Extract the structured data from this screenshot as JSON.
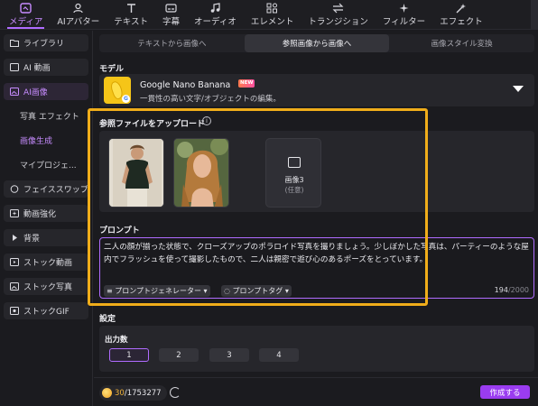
{
  "toolbar": {
    "items": [
      {
        "label": "メディア",
        "icon": "media-icon",
        "active": true
      },
      {
        "label": "AIアバター",
        "icon": "avatar-icon"
      },
      {
        "label": "テキスト",
        "icon": "text-icon"
      },
      {
        "label": "字幕",
        "icon": "caption-icon"
      },
      {
        "label": "オーディオ",
        "icon": "audio-icon"
      },
      {
        "label": "エレメント",
        "icon": "element-icon"
      },
      {
        "label": "トランジション",
        "icon": "transition-icon"
      },
      {
        "label": "フィルター",
        "icon": "filter-icon"
      },
      {
        "label": "エフェクト",
        "icon": "effect-icon"
      }
    ]
  },
  "sidebar": {
    "items": [
      {
        "label": "ライブラリ",
        "icon": "folder-icon"
      },
      {
        "label": "AI 動画",
        "icon": "ai-video-icon"
      },
      {
        "label": "AI画像",
        "icon": "ai-image-icon",
        "active": true
      },
      {
        "label": "写真 エフェクト",
        "sub": true
      },
      {
        "label": "画像生成",
        "sub": true,
        "active": true
      },
      {
        "label": "マイプロジェ...",
        "sub": true
      },
      {
        "label": "フェイススワップ",
        "icon": "face-swap-icon"
      },
      {
        "label": "動画強化",
        "icon": "enhance-icon"
      },
      {
        "label": "背景",
        "icon": "triangle-icon"
      },
      {
        "label": "ストック動画",
        "icon": "stock-video-icon"
      },
      {
        "label": "ストック写真",
        "icon": "stock-photo-icon"
      },
      {
        "label": "ストックGIF",
        "icon": "gif-icon"
      }
    ]
  },
  "tabs": [
    {
      "label": "テキストから画像へ"
    },
    {
      "label": "参照画像から画像へ",
      "active": true
    },
    {
      "label": "画像スタイル変換"
    }
  ],
  "model": {
    "section_title": "モデル",
    "name": "Google Nano Banana",
    "badge": "NEW",
    "description": "一貫性の高い文字/オブジェクトの編集。"
  },
  "reference": {
    "section_title": "参照ファイルをアップロード",
    "slot3_label": "画像3",
    "slot3_sub": "(任意)"
  },
  "prompt": {
    "section_title": "プロンプト",
    "text": "二人の顔が揃った状態で、クローズアップのポラロイド写真を撮りましょう。少しぼかした写真は、パーティーのような屋内でフラッシュを使って撮影したもので、二人は親密で遊び心のあるポーズをとっています。",
    "generator_button": "プロンプトジェネレーター",
    "tag_button": "プロンプトタグ",
    "char_count": "194",
    "char_max": "/2000"
  },
  "settings": {
    "section_title": "設定",
    "output_label": "出力数",
    "options": [
      "1",
      "2",
      "3",
      "4"
    ],
    "selected": "1"
  },
  "footer": {
    "credits_current": "30",
    "credits_total": "/1753277",
    "create_button": "作成する"
  },
  "colors": {
    "accent": "#b06cff",
    "highlight_frame": "#f0ad1a",
    "create_button": "#9a3cf0",
    "credits": "#f0b23a"
  }
}
